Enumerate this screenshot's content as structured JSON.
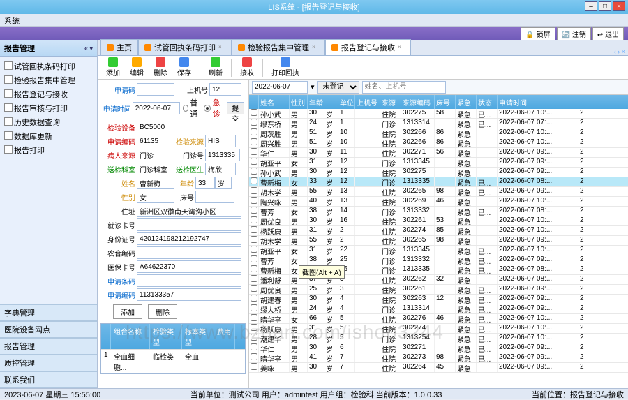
{
  "app": {
    "title": "LIS系统 - [报告登记与接收]",
    "menu": "系统"
  },
  "topbar": {
    "btn1": "🔒 锁屏",
    "btn2": "🔄 注销",
    "btn3": "↩ 退出"
  },
  "nav": {
    "head": "报告管理",
    "items": [
      "试管回执条码打印",
      "检验报告集中管理",
      "报告登记与接收",
      "报告审核与打印",
      "历史数据查询",
      "数据库更新",
      "报告打印"
    ],
    "cats": [
      "字典管理",
      "医院设备网点",
      "报告管理",
      "质控管理",
      "联系我们"
    ]
  },
  "tabs": {
    "t0": "主页",
    "t1": "试管回执条码打印",
    "t2": "检验报告集中管理",
    "t3": "报告登记与接收",
    "mdi": "‹ › ×"
  },
  "tool": {
    "add": "添加",
    "edit": "编辑",
    "del": "删除",
    "save": "保存",
    "refresh": "刷新",
    "recv": "接收",
    "print": "打印回执"
  },
  "form": {
    "l_apply": "申请码",
    "l_mach": "上机号",
    "v_mach": "12",
    "l_atime": "申请时间",
    "v_atime": "2022-06-07",
    "r1": "普通",
    "r2": "急诊",
    "btn_submit": "提交",
    "l_dev": "检验设备",
    "v_dev": "BC5000",
    "l_sample": "申请编码",
    "v_sample": "61135",
    "l_ssrc": "检验来源",
    "v_ssrc": "HIS",
    "l_psrc": "病人来源",
    "v_psrc": "门诊",
    "l_clinic": "门诊号",
    "v_clinic": "1313335",
    "l_dept": "送检科室",
    "v_dept": "门诊科室",
    "l_doc": "送检医生",
    "v_doc": "梅欣",
    "l_name": "姓名",
    "v_name": "曹新梅",
    "l_age": "年龄",
    "v_age": "33",
    "l_ageu": "岁",
    "l_sex": "性别",
    "v_sex": "女",
    "l_bed": "床号",
    "v_bed": "",
    "l_addr": "住址",
    "v_addr": "新洲区双徽南天湾沟小区",
    "l_visit": "就诊卡号",
    "v_visit": "",
    "l_id": "身份证号",
    "v_id": "420124198212192747",
    "l_farm": "农合编码",
    "v_farm": "",
    "l_ins": "医保卡号",
    "v_ins": "A64622370",
    "l_bar": "申请条码",
    "v_bar": "",
    "l_acode": "申请编码",
    "v_acode": "113133357",
    "btn_add": "添加",
    "btn_del": "删除"
  },
  "testgrid": {
    "h1": "组合名称",
    "h2": "检验类型",
    "h3": "标本类型",
    "h4": "费用",
    "r1": "1",
    "r1a": "全血细胞...",
    "r1b": "临检类",
    "r1c": "全血"
  },
  "filter": {
    "date": "2022-06-07",
    "state": "未登记",
    "ph": "姓名、上机号"
  },
  "ghead": {
    "c0": "",
    "c1": "姓名",
    "c2": "性别",
    "c3": "年龄",
    "c4": "",
    "c5": "单位",
    "c6": "上机号",
    "c7": "来源",
    "c8": "来源编码",
    "c9": "床号",
    "c10": "紧急",
    "c11": "状态",
    "c12": "申请时间",
    "c13": ""
  },
  "rows": [
    {
      "n": "孙小武",
      "s": "男",
      "a": "30",
      "au": "岁",
      "u": "1",
      "m": "",
      "sr": "住院",
      "si": "302275",
      "b": "58",
      "ur": "紧急",
      "st": "已...",
      "t": "2022-06-07 10:..."
    },
    {
      "n": "缪东桥",
      "s": "男",
      "a": "24",
      "au": "岁",
      "u": "1",
      "m": "",
      "sr": "门诊",
      "si": "1313314",
      "b": "",
      "ur": "紧急",
      "st": "已...",
      "t": "2022-06-07 07:..."
    },
    {
      "n": "周灰胜",
      "s": "男",
      "a": "51",
      "au": "岁",
      "u": "10",
      "m": "",
      "sr": "住院",
      "si": "302266",
      "b": "86",
      "ur": "紧急",
      "st": "",
      "t": "2022-06-07 10:..."
    },
    {
      "n": "周兴胜",
      "s": "男",
      "a": "51",
      "au": "岁",
      "u": "10",
      "m": "",
      "sr": "住院",
      "si": "302266",
      "b": "86",
      "ur": "紧急",
      "st": "",
      "t": "2022-06-07 10:..."
    },
    {
      "n": "华仁",
      "s": "男",
      "a": "30",
      "au": "岁",
      "u": "11",
      "m": "",
      "sr": "住院",
      "si": "302271",
      "b": "56",
      "ur": "紧急",
      "st": "",
      "t": "2022-06-07 09:..."
    },
    {
      "n": "胡亚平",
      "s": "女",
      "a": "31",
      "au": "岁",
      "u": "12",
      "m": "",
      "sr": "门诊",
      "si": "1313345",
      "b": "",
      "ur": "紧急",
      "st": "",
      "t": "2022-06-07 09:..."
    },
    {
      "n": "孙小武",
      "s": "男",
      "a": "30",
      "au": "岁",
      "u": "12",
      "m": "",
      "sr": "住院",
      "si": "302275",
      "b": "",
      "ur": "紧急",
      "st": "",
      "t": "2022-06-07 09:..."
    },
    {
      "n": "曹新梅",
      "s": "女",
      "a": "33",
      "au": "岁",
      "u": "12",
      "m": "",
      "sr": "门诊",
      "si": "1313335",
      "b": "",
      "ur": "紧急",
      "st": "已...",
      "t": "2022-06-07 08:...",
      "sel": true
    },
    {
      "n": "胡木学",
      "s": "男",
      "a": "55",
      "au": "岁",
      "u": "13",
      "m": "",
      "sr": "住院",
      "si": "302265",
      "b": "98",
      "ur": "紧急",
      "st": "已...",
      "t": "2022-06-07 09:..."
    },
    {
      "n": "陶兴咏",
      "s": "男",
      "a": "40",
      "au": "岁",
      "u": "13",
      "m": "",
      "sr": "住院",
      "si": "302269",
      "b": "46",
      "ur": "紧急",
      "st": "",
      "t": "2022-06-07 10:..."
    },
    {
      "n": "曹芳",
      "s": "女",
      "a": "38",
      "au": "岁",
      "u": "14",
      "m": "",
      "sr": "门诊",
      "si": "1313332",
      "b": "",
      "ur": "紧急",
      "st": "已...",
      "t": "2022-06-07 08:..."
    },
    {
      "n": "周优良",
      "s": "男",
      "a": "30",
      "au": "岁",
      "u": "16",
      "m": "",
      "sr": "住院",
      "si": "302261",
      "b": "53",
      "ur": "紧急",
      "st": "",
      "t": "2022-06-07 10:..."
    },
    {
      "n": "杨跃康",
      "s": "男",
      "a": "31",
      "au": "岁",
      "u": "2",
      "m": "",
      "sr": "住院",
      "si": "302274",
      "b": "85",
      "ur": "紧急",
      "st": "",
      "t": "2022-06-07 10:..."
    },
    {
      "n": "胡木学",
      "s": "男",
      "a": "55",
      "au": "岁",
      "u": "2",
      "m": "",
      "sr": "住院",
      "si": "302265",
      "b": "98",
      "ur": "紧急",
      "st": "",
      "t": "2022-06-07 09:..."
    },
    {
      "n": "胡亚平",
      "s": "女",
      "a": "31",
      "au": "岁",
      "u": "22",
      "m": "",
      "sr": "门诊",
      "si": "1313345",
      "b": "",
      "ur": "紧急",
      "st": "已...",
      "t": "2022-06-07 10:..."
    },
    {
      "n": "曹芳",
      "s": "女",
      "a": "38",
      "au": "岁",
      "u": "25",
      "m": "",
      "sr": "门诊",
      "si": "1313332",
      "b": "",
      "ur": "紧急",
      "st": "已...",
      "t": "2022-06-07 09:..."
    },
    {
      "n": "曹新梅",
      "s": "女",
      "a": "39",
      "au": "岁",
      "u": "26",
      "m": "",
      "sr": "门诊",
      "si": "1313335",
      "b": "",
      "ur": "紧急",
      "st": "已...",
      "t": "2022-06-07 08:..."
    },
    {
      "n": "潘利舒",
      "s": "男",
      "a": "37",
      "au": "岁",
      "u": "3",
      "m": "",
      "sr": "住院",
      "si": "302262",
      "b": "32",
      "ur": "紧急",
      "st": "",
      "t": "2022-06-07 08:..."
    },
    {
      "n": "周优良",
      "s": "男",
      "a": "25",
      "au": "岁",
      "u": "3",
      "m": "",
      "sr": "住院",
      "si": "302261",
      "b": "",
      "ur": "紧急",
      "st": "已...",
      "t": "2022-06-07 09:..."
    },
    {
      "n": "胡建春",
      "s": "男",
      "a": "30",
      "au": "岁",
      "u": "4",
      "m": "",
      "sr": "住院",
      "si": "302263",
      "b": "12",
      "ur": "紧急",
      "st": "已...",
      "t": "2022-06-07 09:..."
    },
    {
      "n": "缪大桥",
      "s": "男",
      "a": "24",
      "au": "岁",
      "u": "4",
      "m": "",
      "sr": "门诊",
      "si": "1313314",
      "b": "",
      "ur": "紧急",
      "st": "已...",
      "t": "2022-06-07 09:..."
    },
    {
      "n": "晴华亭",
      "s": "女",
      "a": "66",
      "au": "岁",
      "u": "5",
      "m": "",
      "sr": "住院",
      "si": "302276",
      "b": "46",
      "ur": "紧急",
      "st": "已...",
      "t": "2022-06-07 10:..."
    },
    {
      "n": "杨跃康",
      "s": "男",
      "a": "31",
      "au": "岁",
      "u": "5",
      "m": "",
      "sr": "住院",
      "si": "302274",
      "b": "",
      "ur": "紧急",
      "st": "已...",
      "t": "2022-06-07 10:..."
    },
    {
      "n": "潮建华",
      "s": "男",
      "a": "28",
      "au": "岁",
      "u": "5",
      "m": "",
      "sr": "门诊",
      "si": "1313254",
      "b": "",
      "ur": "紧急",
      "st": "已...",
      "t": "2022-06-07 10:..."
    },
    {
      "n": "华仁",
      "s": "男",
      "a": "30",
      "au": "岁",
      "u": "6",
      "m": "",
      "sr": "住院",
      "si": "302271",
      "b": "",
      "ur": "紧急",
      "st": "已...",
      "t": "2022-06-07 09:..."
    },
    {
      "n": "晴华亭",
      "s": "男",
      "a": "41",
      "au": "岁",
      "u": "7",
      "m": "",
      "sr": "住院",
      "si": "302273",
      "b": "98",
      "ur": "紧急",
      "st": "已...",
      "t": "2022-06-07 09:..."
    },
    {
      "n": "姜咏",
      "s": "男",
      "a": "30",
      "au": "岁",
      "u": "7",
      "m": "",
      "sr": "住院",
      "si": "302264",
      "b": "45",
      "ur": "紧急",
      "st": "",
      "t": "2022-06-07 09:..."
    }
  ],
  "tooltip": "截图(Alt + A)",
  "status": {
    "left": "2023-06-07 星期三 15:55:00",
    "mid": "当前单位：测试公司    用户：admintest    用户组：检验科  当前版本：1.0.0.33",
    "right": "当前位置：报告登记与接收"
  },
  "watermark": "https://www.bzhan.com/ishop3244"
}
